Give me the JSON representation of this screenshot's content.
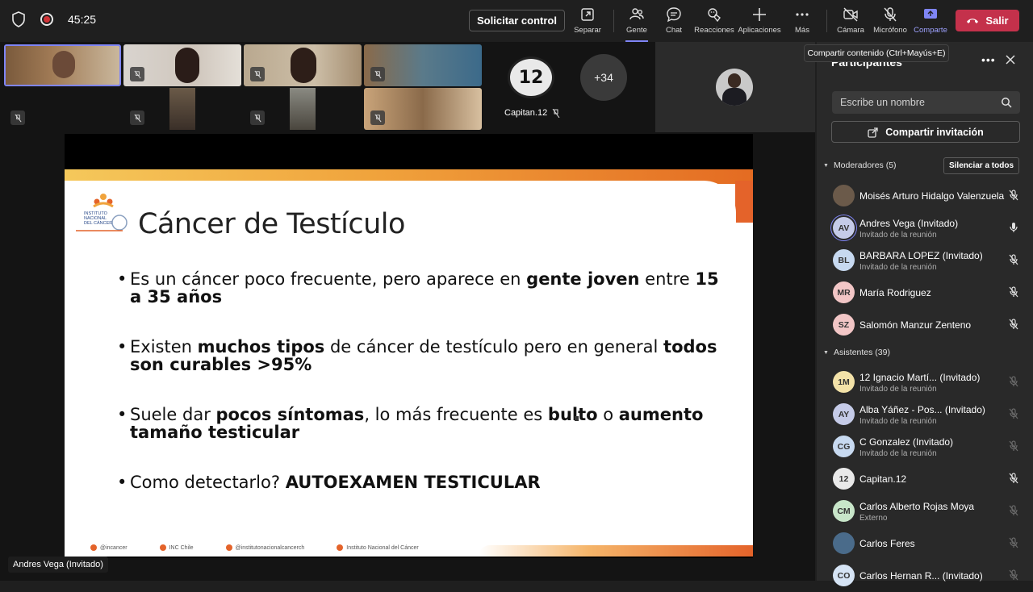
{
  "topbar": {
    "timer": "45:25",
    "request_control": "Solicitar control",
    "tools": [
      {
        "label": "Separar",
        "icon": "popout-icon"
      },
      {
        "label": "Gente",
        "icon": "people-icon"
      },
      {
        "label": "Chat",
        "icon": "chat-icon"
      },
      {
        "label": "Reacciones",
        "icon": "reactions-icon"
      },
      {
        "label": "Aplicaciones",
        "icon": "apps-plus-icon"
      },
      {
        "label": "Más",
        "icon": "more-icon"
      },
      {
        "label": "Cámara",
        "icon": "camera-off-icon"
      },
      {
        "label": "Micrófono",
        "icon": "mic-off-icon"
      },
      {
        "label": "Comparte",
        "icon": "share-icon"
      }
    ],
    "leave": "Salir",
    "tooltip": "Compartir contenido (Ctrl+Mayús+E)",
    "leave_color": "#c4314b",
    "accent": "#7f85f5"
  },
  "stage": {
    "overflow_count": "+34",
    "capitan_name": "Capitan.12",
    "capitan_logo_text": "12",
    "presenter_label": "Andres Vega (Invitado)"
  },
  "slide": {
    "title": "Cáncer de Testículo",
    "bullets": [
      {
        "parts": [
          {
            "t": "Es un cáncer poco frecuente, pero aparece en ",
            "b": false
          },
          {
            "t": "gente joven",
            "b": true
          },
          {
            "t": " entre ",
            "b": false
          },
          {
            "t": "15 a 35 años",
            "b": true
          }
        ]
      },
      {
        "parts": [
          {
            "t": "Existen ",
            "b": false
          },
          {
            "t": "muchos tipos",
            "b": true
          },
          {
            "t": " de cáncer de testículo pero en general ",
            "b": false
          },
          {
            "t": "todos son curables >95%",
            "b": true
          }
        ]
      },
      {
        "parts": [
          {
            "t": "Suele dar ",
            "b": false
          },
          {
            "t": "pocos síntomas",
            "b": true
          },
          {
            "t": ", lo más frecuente es ",
            "b": false
          },
          {
            "t": "bulto",
            "b": true
          },
          {
            "t": " o ",
            "b": false
          },
          {
            "t": "aumento tamaño testicular",
            "b": true
          }
        ]
      },
      {
        "parts": [
          {
            "t": "Como detectarlo? ",
            "b": false
          },
          {
            "t": "AUTOEXAMEN TESTICULAR",
            "b": true
          }
        ]
      }
    ],
    "footer": [
      "@incancer",
      "INC Chile",
      "@institutonacionalcancerch",
      "Instituto Nacional del Cáncer"
    ]
  },
  "panel": {
    "title": "Participantes",
    "search_placeholder": "Escribe un nombre",
    "invite": "Compartir invitación",
    "moderators_label": "Moderadores (5)",
    "mute_all": "Silenciar a todos",
    "attendees_label": "Asistentes (39)",
    "moderators": [
      {
        "name": "Moisés Arturo Hidalgo Valenzuela",
        "sub": "",
        "initials": "",
        "bg": "#6b5a4a",
        "mic": "muted"
      },
      {
        "name": "Andres Vega (Invitado)",
        "sub": "Invitado de la reunión",
        "initials": "AV",
        "bg": "#c5cbe8",
        "mic": "on"
      },
      {
        "name": "BARBARA LOPEZ (Invitado)",
        "sub": "Invitado de la reunión",
        "initials": "BL",
        "bg": "#c7d9f0",
        "mic": "muted"
      },
      {
        "name": "María Rodriguez",
        "sub": "",
        "initials": "MR",
        "bg": "#f2c6c6",
        "mic": "muted"
      },
      {
        "name": "Salomón Manzur Zenteno",
        "sub": "",
        "initials": "SZ",
        "bg": "#f2c6c6",
        "mic": "muted"
      }
    ],
    "attendees": [
      {
        "name": "12 Ignacio Martí... (Invitado)",
        "sub": "Invitado de la reunión",
        "initials": "1M",
        "bg": "#f3e2a8",
        "mic": "off"
      },
      {
        "name": "Alba Yáñez - Pos... (Invitado)",
        "sub": "Invitado de la reunión",
        "initials": "AY",
        "bg": "#c5cbe8",
        "mic": "off"
      },
      {
        "name": "C Gonzalez (Invitado)",
        "sub": "Invitado de la reunión",
        "initials": "CG",
        "bg": "#c7d9f0",
        "mic": "off"
      },
      {
        "name": "Capitan.12",
        "sub": "",
        "initials": "12",
        "bg": "#e9e9e9",
        "mic": "muted"
      },
      {
        "name": "Carlos Alberto Rojas Moya",
        "sub": "Externo",
        "initials": "CM",
        "bg": "#c8e6c9",
        "mic": "off"
      },
      {
        "name": "Carlos Feres",
        "sub": "",
        "initials": "",
        "bg": "#4a6b8a",
        "mic": "off"
      },
      {
        "name": "Carlos Hernan R... (Invitado)",
        "sub": "",
        "initials": "CO",
        "bg": "#d6e4f5",
        "mic": "off"
      }
    ]
  }
}
